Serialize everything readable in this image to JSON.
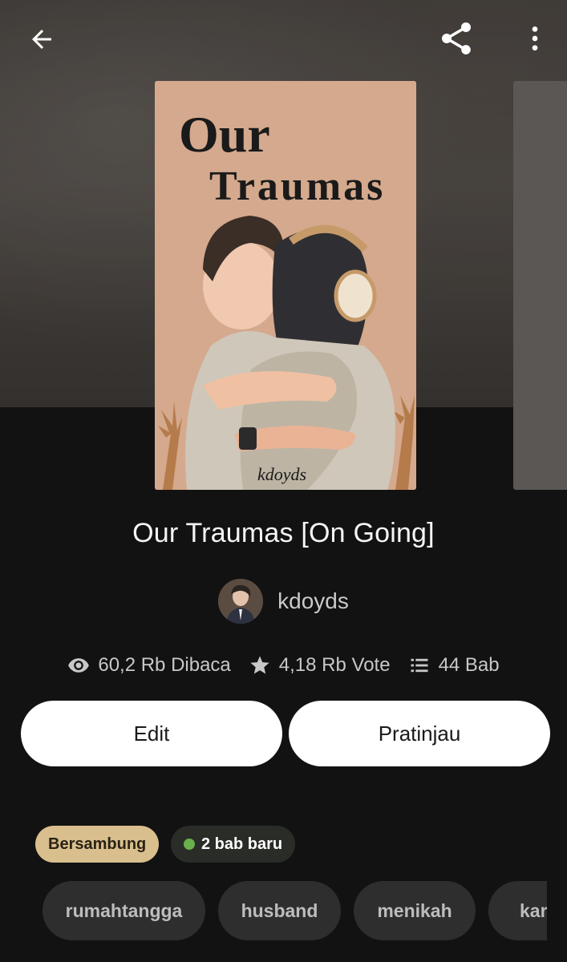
{
  "book": {
    "title": "Our Traumas [On Going]",
    "cover_title_line1": "Our",
    "cover_title_line2": "Traumas",
    "cover_signature": "kdoyds"
  },
  "author": {
    "name": "kdoyds"
  },
  "stats": {
    "reads": "60,2 Rb Dibaca",
    "votes": "4,18 Rb Vote",
    "chapters": "44 Bab"
  },
  "actions": {
    "edit_label": "Edit",
    "preview_label": "Pratinjau"
  },
  "status": {
    "label": "Bersambung",
    "new_chapters": "2 bab baru"
  },
  "tags": [
    "rumahtangga",
    "husband",
    "menikah",
    "kar"
  ],
  "icons": {
    "back": "arrow-left-icon",
    "share": "share-icon",
    "more": "more-vertical-icon",
    "reads": "eye-icon",
    "votes": "star-icon",
    "chapters": "list-icon"
  },
  "colors": {
    "background": "#121212",
    "status_chip": "#d9bf8d",
    "new_dot": "#6ab04c",
    "tag_bg": "#2e2e2e",
    "button_bg": "#ffffff"
  }
}
